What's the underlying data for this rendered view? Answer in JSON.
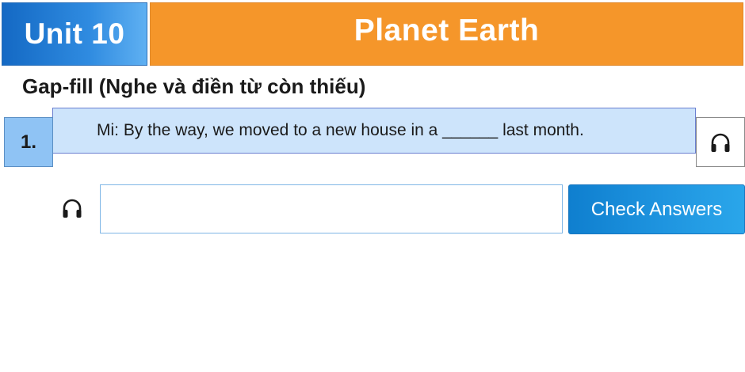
{
  "header": {
    "unit_label": "Unit 10",
    "title": "Planet Earth"
  },
  "instruction": "Gap-fill (Nghe và điền từ còn thiếu)",
  "question": {
    "number": "1.",
    "text": "Mi: By the way, we moved to a new house in a ______ last month."
  },
  "answer": {
    "value": "",
    "placeholder": ""
  },
  "check_button_label": "Check Answers",
  "icons": {
    "question_audio": "headphones-icon",
    "answer_audio": "headphones-icon"
  },
  "colors": {
    "unit_blue": "#1f7fd8",
    "title_orange": "#f5962a",
    "question_bg": "#cde4fb",
    "number_bg": "#8fc3f4",
    "button_blue": "#1a8ed9"
  }
}
